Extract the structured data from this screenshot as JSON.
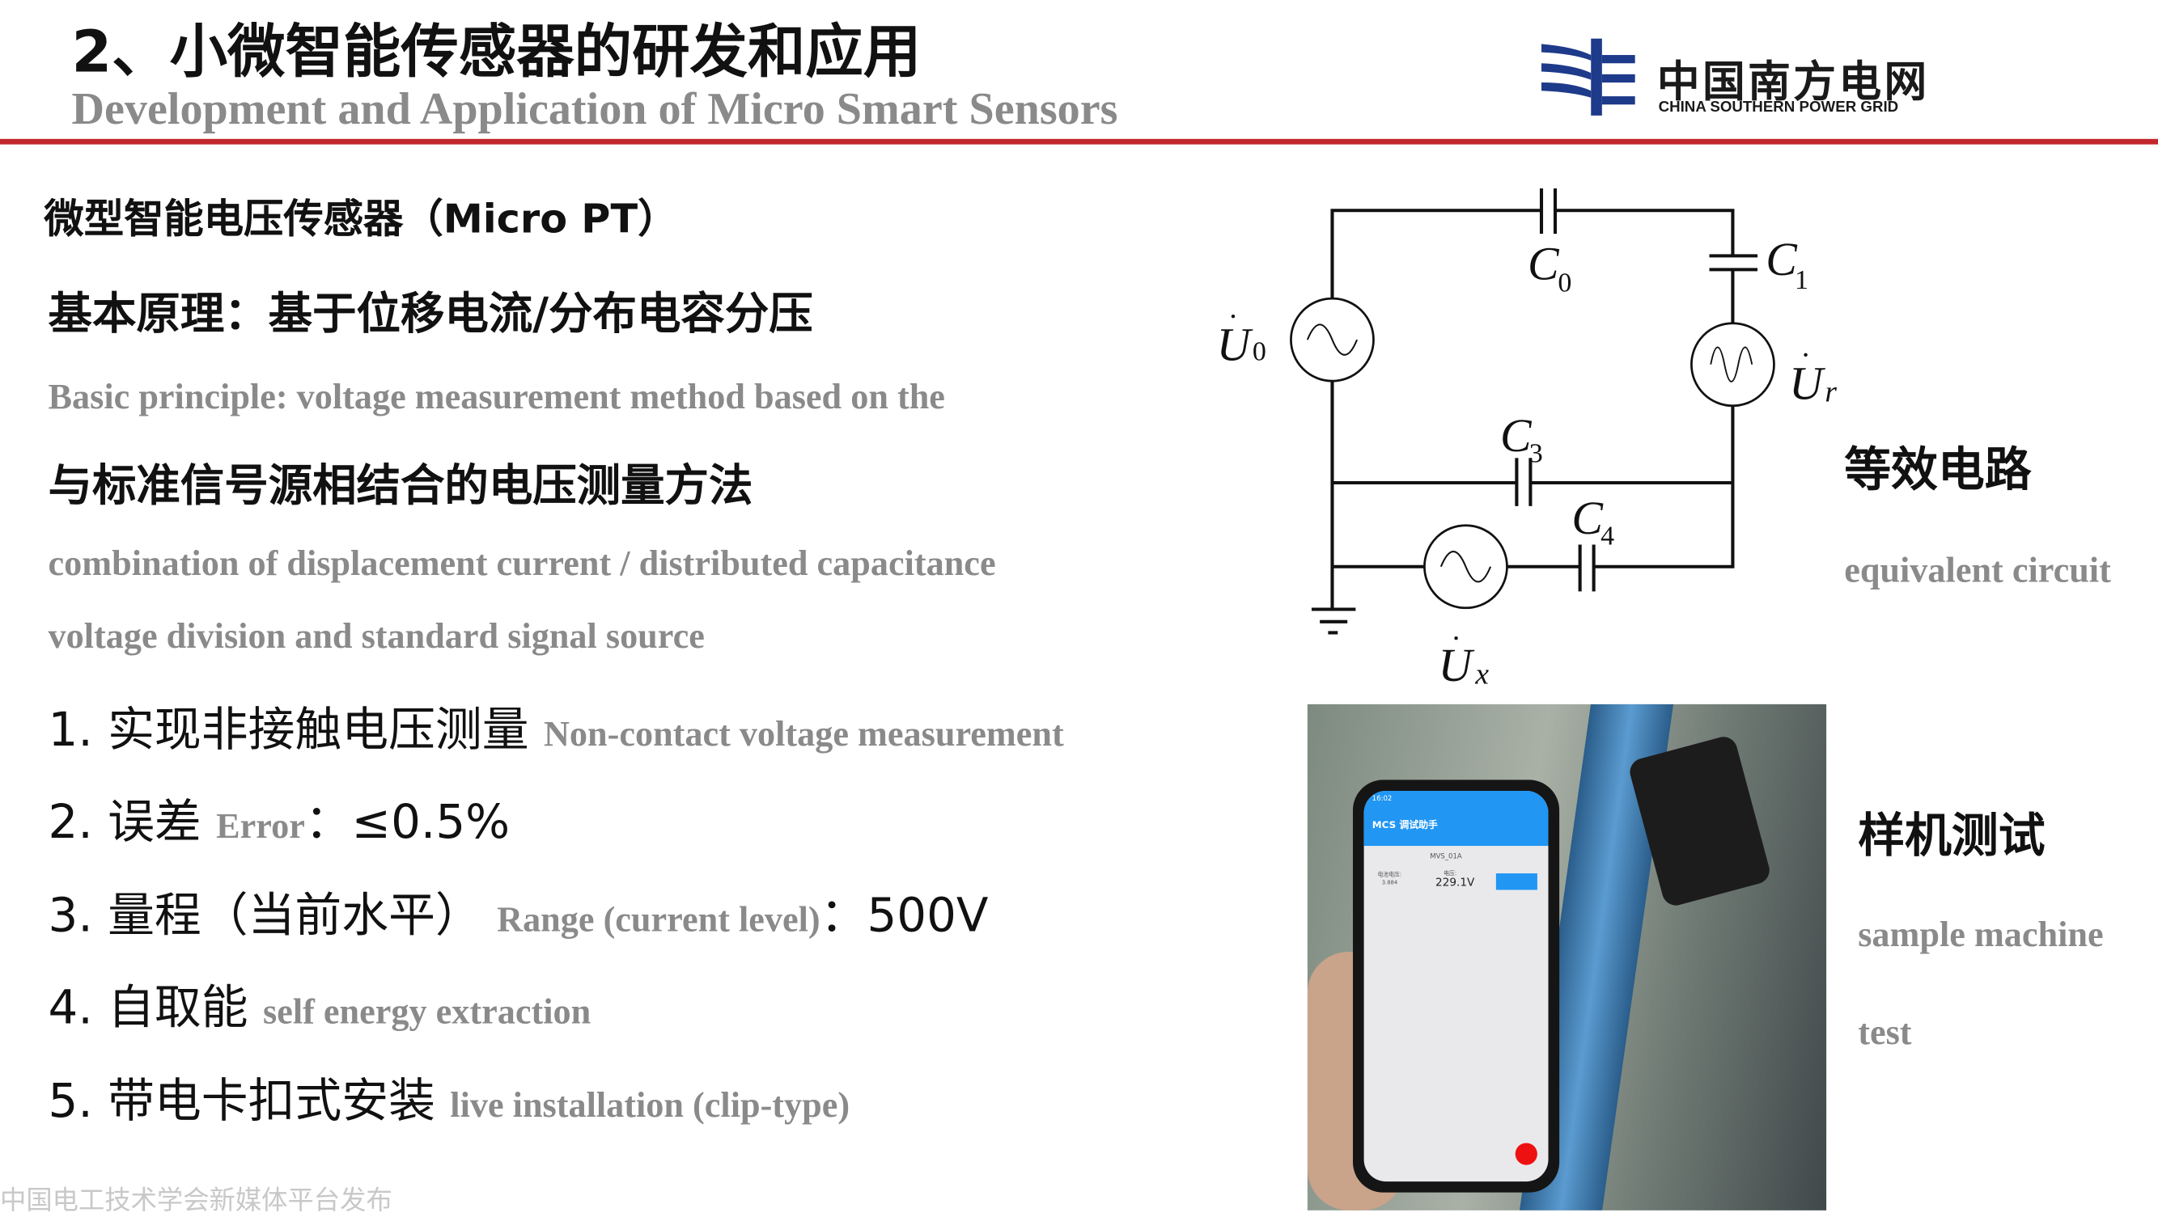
{
  "header": {
    "title_cn": "2、小微智能传感器的研发和应用",
    "title_en": "Development and Application of Micro Smart Sensors",
    "accent_color": "#c0272d"
  },
  "logo": {
    "name_cn": "中国南方电网",
    "name_en": "CHINA SOUTHERN POWER GRID",
    "color": "#1e3a8a"
  },
  "left": {
    "heading1": "微型智能电压传感器（Micro PT）",
    "principle_cn_1": "基本原理：基于位移电流/分布电容分压",
    "principle_en_1": "Basic principle: voltage measurement method based on the",
    "principle_cn_2": "与标准信号源相结合的电压测量方法",
    "principle_en_2": "combination of displacement current / distributed capacitance",
    "principle_en_3": "voltage division and standard signal source",
    "items": [
      {
        "cn": "1. 实现非接触电压测量",
        "en": "Non-contact voltage measurement",
        "tail": ""
      },
      {
        "cn": "2. 误差",
        "en": "Error",
        "tail": "：≤0.5%"
      },
      {
        "cn": "3. 量程（当前水平）",
        "en": "Range (current level)",
        "tail": "：500V"
      },
      {
        "cn": "4. 自取能",
        "en": "self energy extraction",
        "tail": ""
      },
      {
        "cn": "5. 带电卡扣式安装",
        "en": "live installation (clip-type)",
        "tail": ""
      }
    ]
  },
  "circuit": {
    "labels": {
      "C0": "C",
      "C0_sub": "0",
      "C1": "C",
      "C1_sub": "1",
      "C3": "C",
      "C3_sub": "3",
      "C4": "C",
      "C4_sub": "4",
      "U0": "U",
      "U0_sub": "0",
      "Ur": "U",
      "Ur_sub": "r",
      "Ux": "U",
      "Ux_sub": "x"
    },
    "caption_cn": "等效电路",
    "caption_en": "equivalent circuit"
  },
  "prototype": {
    "caption_cn": "样机测试",
    "caption_en_1": "sample machine",
    "caption_en_2": "test",
    "phone": {
      "time": "16:02",
      "app_title": "MCS 调试助手",
      "device": "MVS_01A",
      "battery_label": "电池电压:",
      "battery_value": "3.884",
      "voltage_label": "电压:",
      "voltage_value": "229.1V",
      "app_color": "#2196f3"
    }
  },
  "footer": {
    "watermark": "中国电工技术学会新媒体平台发布"
  }
}
